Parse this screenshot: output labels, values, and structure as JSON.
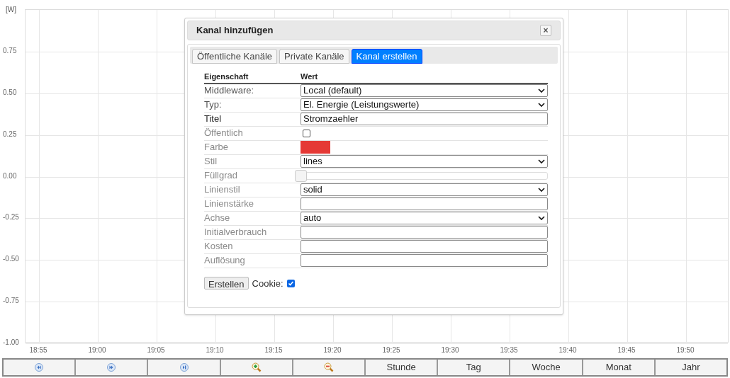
{
  "chart": {
    "unit": "[W]",
    "yticks": [
      "0.75",
      "0.50",
      "0.25",
      "0.00",
      "-0.25",
      "-0.50",
      "-0.75",
      "-1.00"
    ],
    "xticks": [
      "18:55",
      "19:00",
      "19:05",
      "19:10",
      "19:15",
      "19:20",
      "19:25",
      "19:30",
      "19:35",
      "19:40",
      "19:45",
      "19:50"
    ]
  },
  "dialog": {
    "title": "Kanal hinzufügen",
    "close": "×",
    "tabs": [
      {
        "label": "Öffentliche Kanäle",
        "selected": false
      },
      {
        "label": "Private Kanäle",
        "selected": false
      },
      {
        "label": "Kanal erstellen",
        "selected": true
      }
    ],
    "columns": [
      "Eigenschaft",
      "Wert"
    ],
    "rows": [
      {
        "label": "Middleware:",
        "kind": "select",
        "value": "Local (default)",
        "disabled": false
      },
      {
        "label": "Typ:",
        "kind": "select",
        "value": "El. Energie (Leistungswerte)",
        "disabled": false
      },
      {
        "label": "Titel",
        "kind": "text",
        "value": "Stromzaehler",
        "disabled": false
      },
      {
        "label": "Öffentlich",
        "kind": "checkbox",
        "checked": false,
        "disabled": true
      },
      {
        "label": "Farbe",
        "kind": "color",
        "color": "#e53935",
        "disabled": true
      },
      {
        "label": "Stil",
        "kind": "select",
        "value": "lines",
        "disabled": true
      },
      {
        "label": "Füllgrad",
        "kind": "slider",
        "level": 0,
        "disabled": true
      },
      {
        "label": "Linienstil",
        "kind": "select",
        "value": "solid",
        "disabled": true
      },
      {
        "label": "Linienstärke",
        "kind": "text",
        "disabled": true
      },
      {
        "label": "Achse",
        "kind": "select",
        "value": "auto",
        "disabled": true
      },
      {
        "label": "Initialverbrauch",
        "kind": "text",
        "disabled": true
      },
      {
        "label": "Kosten",
        "kind": "text",
        "disabled": true
      },
      {
        "label": "Auflösung",
        "kind": "text",
        "disabled": true
      }
    ],
    "submit": "Erstellen",
    "cookie": {
      "label": "Cookie:",
      "checked": true
    }
  },
  "toolbar": [
    {
      "kind": "back"
    },
    {
      "kind": "forward"
    },
    {
      "kind": "end"
    },
    {
      "kind": "zoom_in"
    },
    {
      "kind": "zoom_out"
    },
    {
      "kind": "text",
      "label": "Stunde"
    },
    {
      "kind": "text",
      "label": "Tag"
    },
    {
      "kind": "text",
      "label": "Woche"
    },
    {
      "kind": "text",
      "label": "Monat"
    },
    {
      "kind": "text",
      "label": "Jahr"
    }
  ]
}
